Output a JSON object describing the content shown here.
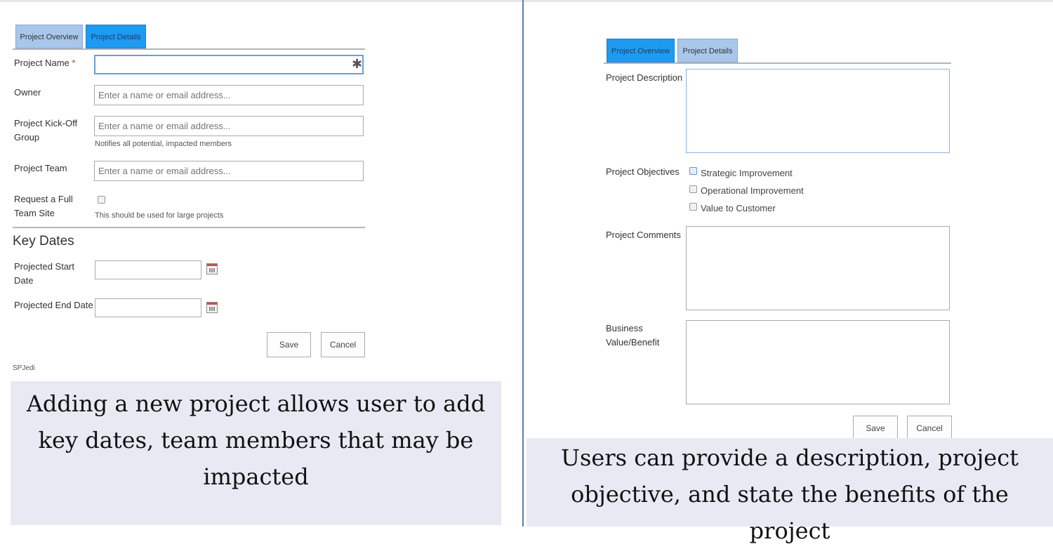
{
  "left": {
    "tabs": [
      {
        "label": "Project Overview",
        "active": false
      },
      {
        "label": "Project Details",
        "active": true
      }
    ],
    "fields": {
      "project_name": {
        "label": "Project Name",
        "required_mark": "*",
        "value": "",
        "right_marker": "✱"
      },
      "owner": {
        "label": "Owner",
        "placeholder": "Enter a name or email address..."
      },
      "kickoff": {
        "label": "Project Kick-Off Group",
        "placeholder": "Enter a name or email address...",
        "hint": "Notifies all potential, impacted members"
      },
      "team": {
        "label": "Project Team",
        "placeholder": "Enter a name or email address..."
      },
      "full_site": {
        "label": "Request a Full Team Site",
        "checked": false,
        "hint": "This should be used for large projects"
      }
    },
    "key_dates": {
      "title": "Key Dates",
      "start_label": "Projected Start Date",
      "end_label": "Projected End Date",
      "calendar_icon": "calendar-icon"
    },
    "buttons": {
      "save": "Save",
      "cancel": "Cancel"
    },
    "footer": "SPJedi",
    "caption": "Adding a new project allows user to add key dates, team members that may be impacted"
  },
  "right": {
    "tabs": [
      {
        "label": "Project Overview",
        "active": true
      },
      {
        "label": "Project Details",
        "active": false
      }
    ],
    "description_label": "Project Description",
    "objectives_label": "Project Objectives",
    "objectives": [
      {
        "label": "Strategic Improvement",
        "checked": false
      },
      {
        "label": "Operational Improvement",
        "checked": false
      },
      {
        "label": "Value to Customer",
        "checked": false
      }
    ],
    "comments_label": "Project Comments",
    "benefit_label": "Business Value/Benefit",
    "buttons": {
      "save": "Save",
      "cancel": "Cancel"
    },
    "caption": "Users can provide a description, project objective, and state the benefits of the project"
  },
  "colors": {
    "active_tab": "#1e9bf0",
    "inactive_tab": "#a9c7ea",
    "caption_bg": "#e7eaf2",
    "required": "#d32f2f"
  }
}
